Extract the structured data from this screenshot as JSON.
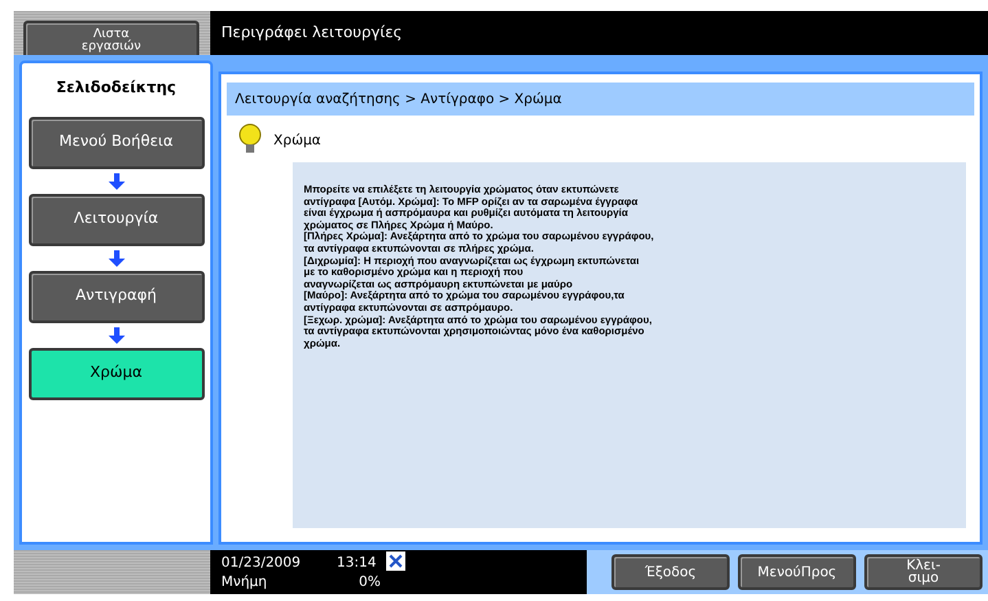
{
  "header": {
    "job_list_button": [
      "Λιστα",
      "εργασιών"
    ],
    "title": "Περιγράφει λειτουργίες"
  },
  "sidebar": {
    "tab": "Σελιδοδείκτης",
    "steps": [
      {
        "label": "Μενού Βοήθεια",
        "selected": false
      },
      {
        "label": "Λειτουργία",
        "selected": false
      },
      {
        "label": "Αντιγραφή",
        "selected": false
      },
      {
        "label": "Χρώμα",
        "selected": true
      }
    ]
  },
  "breadcrumb": "Λειτουργία αναζήτησης > Αντίγραφο > Χρώμα",
  "topic": {
    "title": "Χρώμα",
    "lines": [
      "Μπορείτε να επιλέξετε τη λειτουργία χρώματος όταν εκτυπώνετε",
      "αντίγραφα [Αυτόμ. Χρώμα]: Το MFP ορίζει αν τα σαρωμένα έγγραφα",
      "είναι έγχρωμα ή ασπρόμαυρα και ρυθμίζει αυτόματα τη λειτουργία",
      "χρώματος σε Πλήρες Χρώμα ή Μαύρο.",
      "[Πλήρες Χρώμα]: Ανεξάρτητα από το χρώμα του σαρωμένου εγγράφου,",
      "τα αντίγραφα εκτυπώνονται σε πλήρες χρώμα.",
      "[Διχρωμία]: Η περιοχή που αναγνωρίζεται ως έγχρωμη εκτυπώνεται",
      "με το καθορισμένο χρώμα και η περιοχή που",
      "αναγνωρίζεται ως ασπρόμαυρη εκτυπώνεται με μαύρο",
      "[Μαύρο]: Ανεξάρτητα από το χρώμα του σαρωμένου εγγράφου,τα",
      "αντίγραφα εκτυπώνονται σε ασπρόμαυρο.",
      "[Ξεχωρ. χρώμα]: Ανεξάρτητα από το χρώμα του σαρωμένου εγγράφου,",
      "τα αντίγραφα εκτυπώνονται χρησιμοποιώντας μόνο ένα καθορισμένο",
      "χρώμα."
    ]
  },
  "status_bar": {
    "date": "01/23/2009",
    "time": "13:14",
    "memory_label": "Μνήμη",
    "memory_value": "0%"
  },
  "buttons": [
    [
      "Έξοδος"
    ],
    [
      "ΜενούΠρος"
    ],
    [
      "Κλει-",
      "σιμο"
    ]
  ]
}
